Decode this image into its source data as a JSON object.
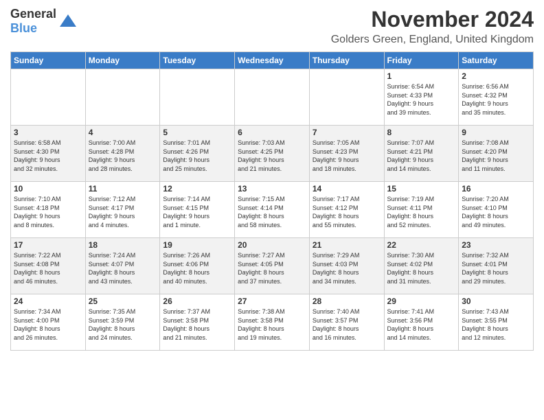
{
  "logo": {
    "general": "General",
    "blue": "Blue"
  },
  "header": {
    "month": "November 2024",
    "location": "Golders Green, England, United Kingdom"
  },
  "days_of_week": [
    "Sunday",
    "Monday",
    "Tuesday",
    "Wednesday",
    "Thursday",
    "Friday",
    "Saturday"
  ],
  "weeks": [
    [
      {
        "day": "",
        "info": ""
      },
      {
        "day": "",
        "info": ""
      },
      {
        "day": "",
        "info": ""
      },
      {
        "day": "",
        "info": ""
      },
      {
        "day": "",
        "info": ""
      },
      {
        "day": "1",
        "info": "Sunrise: 6:54 AM\nSunset: 4:33 PM\nDaylight: 9 hours\nand 39 minutes."
      },
      {
        "day": "2",
        "info": "Sunrise: 6:56 AM\nSunset: 4:32 PM\nDaylight: 9 hours\nand 35 minutes."
      }
    ],
    [
      {
        "day": "3",
        "info": "Sunrise: 6:58 AM\nSunset: 4:30 PM\nDaylight: 9 hours\nand 32 minutes."
      },
      {
        "day": "4",
        "info": "Sunrise: 7:00 AM\nSunset: 4:28 PM\nDaylight: 9 hours\nand 28 minutes."
      },
      {
        "day": "5",
        "info": "Sunrise: 7:01 AM\nSunset: 4:26 PM\nDaylight: 9 hours\nand 25 minutes."
      },
      {
        "day": "6",
        "info": "Sunrise: 7:03 AM\nSunset: 4:25 PM\nDaylight: 9 hours\nand 21 minutes."
      },
      {
        "day": "7",
        "info": "Sunrise: 7:05 AM\nSunset: 4:23 PM\nDaylight: 9 hours\nand 18 minutes."
      },
      {
        "day": "8",
        "info": "Sunrise: 7:07 AM\nSunset: 4:21 PM\nDaylight: 9 hours\nand 14 minutes."
      },
      {
        "day": "9",
        "info": "Sunrise: 7:08 AM\nSunset: 4:20 PM\nDaylight: 9 hours\nand 11 minutes."
      }
    ],
    [
      {
        "day": "10",
        "info": "Sunrise: 7:10 AM\nSunset: 4:18 PM\nDaylight: 9 hours\nand 8 minutes."
      },
      {
        "day": "11",
        "info": "Sunrise: 7:12 AM\nSunset: 4:17 PM\nDaylight: 9 hours\nand 4 minutes."
      },
      {
        "day": "12",
        "info": "Sunrise: 7:14 AM\nSunset: 4:15 PM\nDaylight: 9 hours\nand 1 minute."
      },
      {
        "day": "13",
        "info": "Sunrise: 7:15 AM\nSunset: 4:14 PM\nDaylight: 8 hours\nand 58 minutes."
      },
      {
        "day": "14",
        "info": "Sunrise: 7:17 AM\nSunset: 4:12 PM\nDaylight: 8 hours\nand 55 minutes."
      },
      {
        "day": "15",
        "info": "Sunrise: 7:19 AM\nSunset: 4:11 PM\nDaylight: 8 hours\nand 52 minutes."
      },
      {
        "day": "16",
        "info": "Sunrise: 7:20 AM\nSunset: 4:10 PM\nDaylight: 8 hours\nand 49 minutes."
      }
    ],
    [
      {
        "day": "17",
        "info": "Sunrise: 7:22 AM\nSunset: 4:08 PM\nDaylight: 8 hours\nand 46 minutes."
      },
      {
        "day": "18",
        "info": "Sunrise: 7:24 AM\nSunset: 4:07 PM\nDaylight: 8 hours\nand 43 minutes."
      },
      {
        "day": "19",
        "info": "Sunrise: 7:26 AM\nSunset: 4:06 PM\nDaylight: 8 hours\nand 40 minutes."
      },
      {
        "day": "20",
        "info": "Sunrise: 7:27 AM\nSunset: 4:05 PM\nDaylight: 8 hours\nand 37 minutes."
      },
      {
        "day": "21",
        "info": "Sunrise: 7:29 AM\nSunset: 4:03 PM\nDaylight: 8 hours\nand 34 minutes."
      },
      {
        "day": "22",
        "info": "Sunrise: 7:30 AM\nSunset: 4:02 PM\nDaylight: 8 hours\nand 31 minutes."
      },
      {
        "day": "23",
        "info": "Sunrise: 7:32 AM\nSunset: 4:01 PM\nDaylight: 8 hours\nand 29 minutes."
      }
    ],
    [
      {
        "day": "24",
        "info": "Sunrise: 7:34 AM\nSunset: 4:00 PM\nDaylight: 8 hours\nand 26 minutes."
      },
      {
        "day": "25",
        "info": "Sunrise: 7:35 AM\nSunset: 3:59 PM\nDaylight: 8 hours\nand 24 minutes."
      },
      {
        "day": "26",
        "info": "Sunrise: 7:37 AM\nSunset: 3:58 PM\nDaylight: 8 hours\nand 21 minutes."
      },
      {
        "day": "27",
        "info": "Sunrise: 7:38 AM\nSunset: 3:58 PM\nDaylight: 8 hours\nand 19 minutes."
      },
      {
        "day": "28",
        "info": "Sunrise: 7:40 AM\nSunset: 3:57 PM\nDaylight: 8 hours\nand 16 minutes."
      },
      {
        "day": "29",
        "info": "Sunrise: 7:41 AM\nSunset: 3:56 PM\nDaylight: 8 hours\nand 14 minutes."
      },
      {
        "day": "30",
        "info": "Sunrise: 7:43 AM\nSunset: 3:55 PM\nDaylight: 8 hours\nand 12 minutes."
      }
    ]
  ]
}
